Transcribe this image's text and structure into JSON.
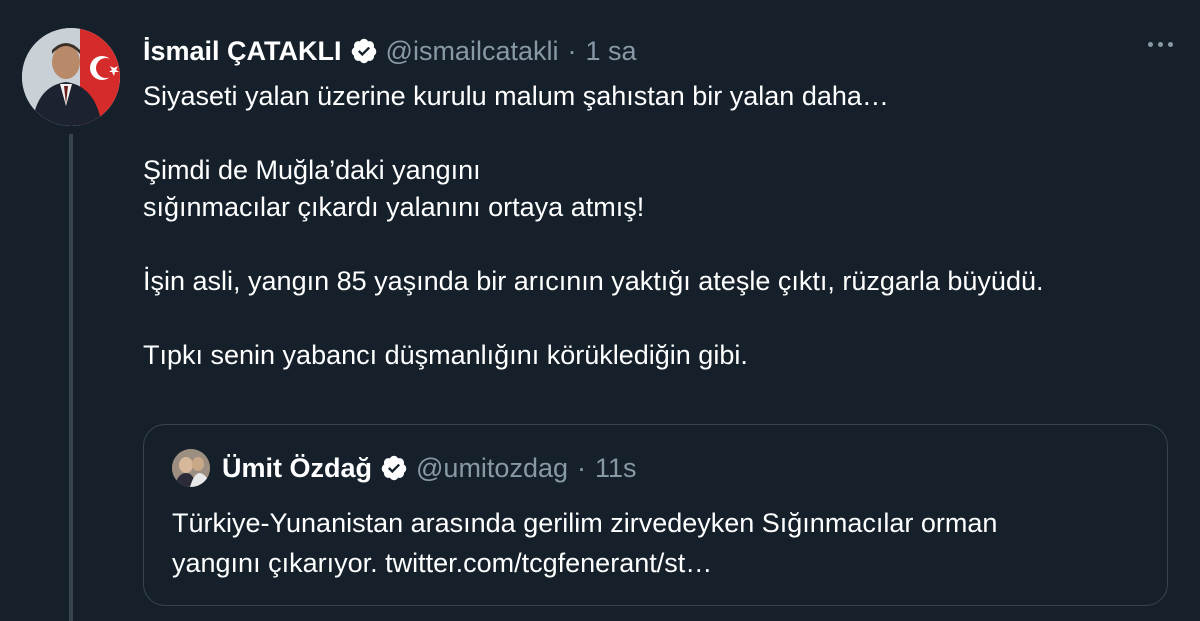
{
  "tweet": {
    "author_name": "İsmail ÇATAKLI",
    "author_handle": "@ismailcatakli",
    "separator": "·",
    "time": "1 sa",
    "verified_icon": "verified-badge-icon",
    "more_icon": "more-options-icon",
    "body_lines": [
      "Siyaseti yalan üzerine kurulu malum şahıstan bir yalan daha…",
      "Şimdi de Muğla’daki yangını",
      "sığınmacılar çıkardı yalanını ortaya atmış!",
      "İşin asli, yangın 85 yaşında bir arıcının yaktığı ateşle çıktı, rüzgarla büyüdü.",
      "Tıpkı senin yabancı düşmanlığını körüklediğin gibi."
    ]
  },
  "quote": {
    "author_name": "Ümit Özdağ",
    "author_handle": "@umitozdag",
    "separator": "·",
    "time": "11s",
    "body_line1": "Türkiye-Yunanistan arasında gerilim zirvedeyken Sığınmacılar orman",
    "body_line2": "yangını çıkarıyor. twitter.com/tcgfenerant/st…"
  },
  "colors": {
    "background": "#15202b",
    "secondary_text": "#8899a6",
    "border": "#38444d",
    "primary_text": "#ffffff"
  }
}
